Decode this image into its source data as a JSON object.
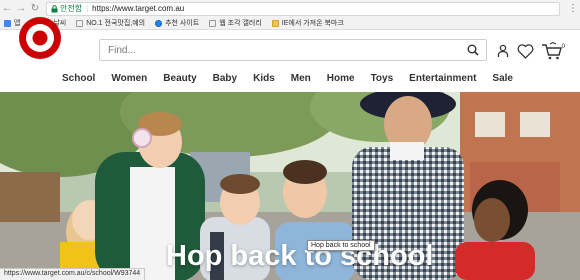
{
  "browser": {
    "secure_label": "안전함",
    "url": "https://www.target.com.au",
    "bookmarks": [
      {
        "label": "앱",
        "icon": "apps-grid-icon"
      },
      {
        "label": "뉴스날씨",
        "icon": "page-icon"
      },
      {
        "label": "NO.1 전국맛집,예의",
        "icon": "page-icon"
      },
      {
        "label": "추천 사이트",
        "icon": "ie-icon"
      },
      {
        "label": "웹 조각 갤러리",
        "icon": "page-icon"
      },
      {
        "label": "IE에서 가져온 북마크",
        "icon": "folder-icon"
      }
    ],
    "status_url": "https://www.target.com.au/c/school/W93744"
  },
  "header": {
    "brand_color": "#cc0000",
    "search_placeholder": "Find...",
    "cart_count": "0",
    "nav": [
      "School",
      "Women",
      "Beauty",
      "Baby",
      "Kids",
      "Men",
      "Home",
      "Toys",
      "Entertainment",
      "Sale"
    ]
  },
  "hero": {
    "headline": "Hop back to school",
    "tooltip": "Hop back to school"
  }
}
